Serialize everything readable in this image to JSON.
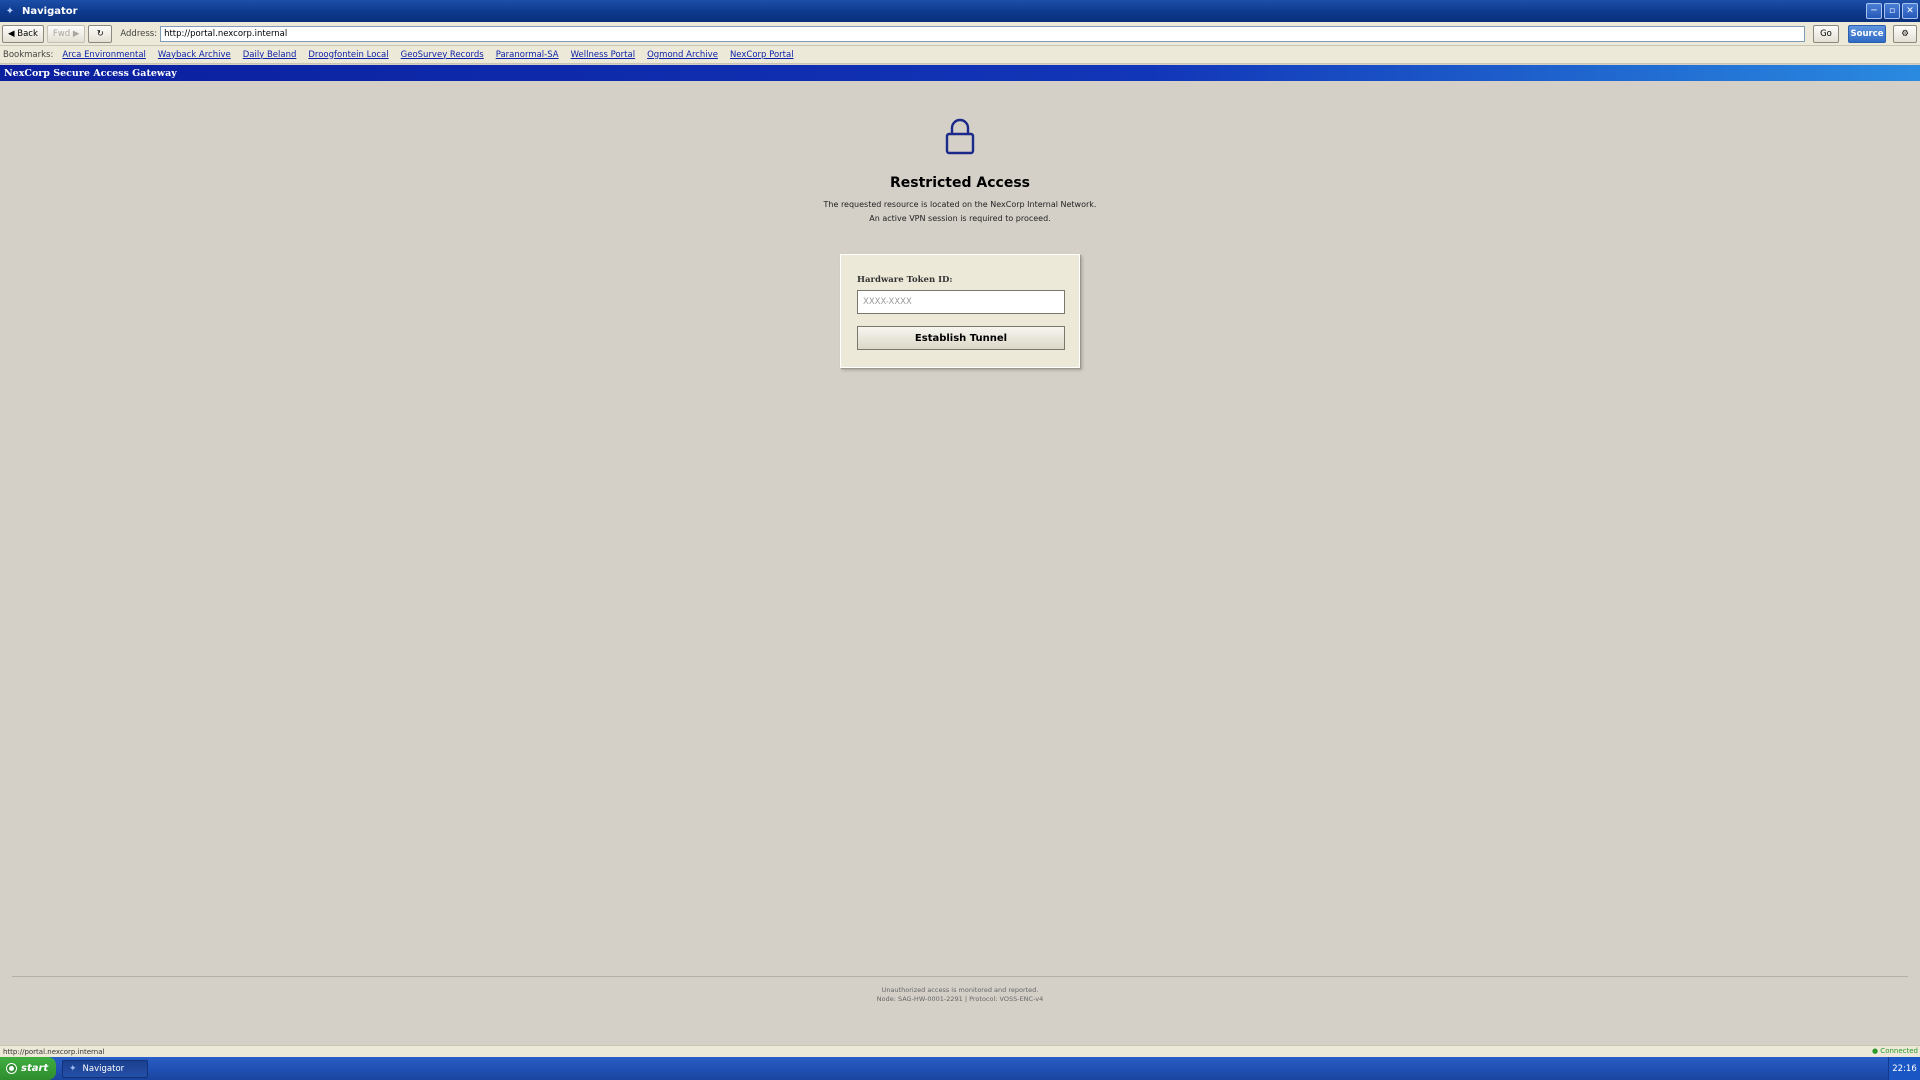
{
  "window": {
    "title": "Navigator",
    "controls": {
      "minimize": "─",
      "maximize": "▫",
      "close": "✕"
    }
  },
  "toolbar": {
    "back_label": "◀ Back",
    "forward_label": "Fwd ▶",
    "reload_label": "↻",
    "address_label": "Address:",
    "address_value": "http://portal.nexcorp.internal",
    "go_label": "Go",
    "source_label": "Source",
    "settings_label": "⚙"
  },
  "bookmarks": {
    "label": "Bookmarks:",
    "items": [
      "Arca Environmental",
      "Wayback Archive",
      "Daily Beland",
      "Droogfontein Local",
      "GeoSurvey Records",
      "Paranormal-SA",
      "Wellness Portal",
      "Ogmond Archive",
      "NexCorp Portal"
    ]
  },
  "page": {
    "header": "NexCorp Secure Access Gateway",
    "heading": "Restricted Access",
    "description_line1": "The requested resource is located on the NexCorp Internal Network.",
    "description_line2": "An active VPN session is required to proceed.",
    "form": {
      "token_label": "Hardware Token ID:",
      "token_placeholder": "XXXX-XXXX",
      "token_value": "",
      "submit_label": "Establish Tunnel"
    },
    "footer_line1": "Unauthorized access is monitored and reported.",
    "footer_line2": "Node: SAG-HW-0001-2291 | Protocol: VOSS-ENC-v4"
  },
  "statusbar": {
    "url": "http://portal.nexcorp.internal",
    "connection": "● Connected"
  },
  "taskbar": {
    "start_label": "start",
    "task_label": "Navigator",
    "clock": "22:16"
  },
  "colors": {
    "titlebar": "#0e3b90",
    "page_header": "#1236b8",
    "background": "#d4d0c8",
    "lock_icon": "#1a2a8a",
    "start_button": "#3fae3f"
  },
  "icons": {
    "app": "navigator-icon",
    "lock": "lock-icon",
    "task": "navigator-icon"
  }
}
